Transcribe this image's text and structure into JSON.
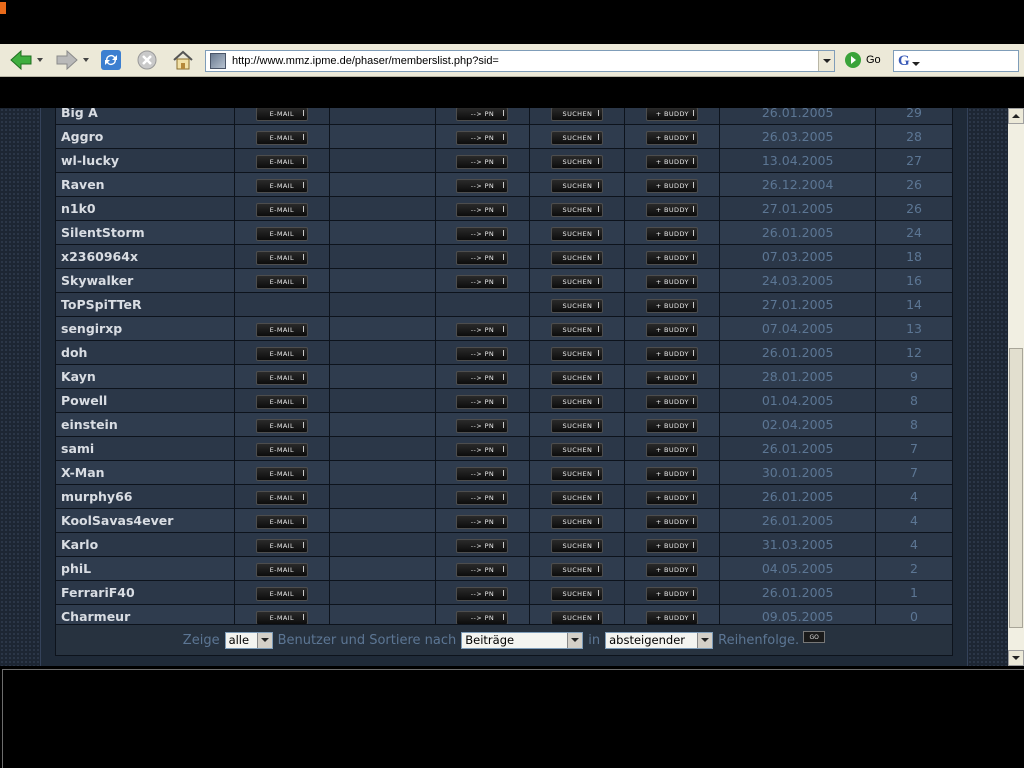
{
  "browser": {
    "url": "http://www.mmz.ipme.de/phaser/memberslist.php?sid=",
    "go_label": "Go",
    "search_engine_letter": "G"
  },
  "buttons": {
    "email": "E-MAIL",
    "pm": "--> PN",
    "search": "SUCHEN",
    "buddy": "+ BUDDY"
  },
  "members": [
    {
      "name": "Big A",
      "email": true,
      "pm": true,
      "date": "26.01.2005",
      "posts": "29"
    },
    {
      "name": "Aggro",
      "email": true,
      "pm": true,
      "date": "26.03.2005",
      "posts": "28"
    },
    {
      "name": "wl-lucky",
      "email": true,
      "pm": true,
      "date": "13.04.2005",
      "posts": "27"
    },
    {
      "name": "Raven",
      "email": true,
      "pm": true,
      "date": "26.12.2004",
      "posts": "26"
    },
    {
      "name": "n1k0",
      "email": true,
      "pm": true,
      "date": "27.01.2005",
      "posts": "26"
    },
    {
      "name": "SilentStorm",
      "email": true,
      "pm": true,
      "date": "26.01.2005",
      "posts": "24"
    },
    {
      "name": "x2360964x",
      "email": true,
      "pm": true,
      "date": "07.03.2005",
      "posts": "18"
    },
    {
      "name": "Skywalker",
      "email": true,
      "pm": true,
      "date": "24.03.2005",
      "posts": "16"
    },
    {
      "name": "ToPSpiTTeR",
      "email": false,
      "pm": false,
      "date": "27.01.2005",
      "posts": "14"
    },
    {
      "name": "sengirxp",
      "email": true,
      "pm": true,
      "date": "07.04.2005",
      "posts": "13"
    },
    {
      "name": "doh",
      "email": true,
      "pm": true,
      "date": "26.01.2005",
      "posts": "12"
    },
    {
      "name": "Kayn",
      "email": true,
      "pm": true,
      "date": "28.01.2005",
      "posts": "9"
    },
    {
      "name": "Powell",
      "email": true,
      "pm": true,
      "date": "01.04.2005",
      "posts": "8"
    },
    {
      "name": "einstein",
      "email": true,
      "pm": true,
      "date": "02.04.2005",
      "posts": "8"
    },
    {
      "name": "sami",
      "email": true,
      "pm": true,
      "date": "26.01.2005",
      "posts": "7"
    },
    {
      "name": "X-Man",
      "email": true,
      "pm": true,
      "date": "30.01.2005",
      "posts": "7"
    },
    {
      "name": "murphy66",
      "email": true,
      "pm": true,
      "date": "26.01.2005",
      "posts": "4"
    },
    {
      "name": "KoolSavas4ever",
      "email": true,
      "pm": true,
      "date": "26.01.2005",
      "posts": "4"
    },
    {
      "name": "Karlo",
      "email": true,
      "pm": true,
      "date": "31.03.2005",
      "posts": "4"
    },
    {
      "name": "phiL",
      "email": true,
      "pm": true,
      "date": "04.05.2005",
      "posts": "2"
    },
    {
      "name": "FerrariF40",
      "email": true,
      "pm": true,
      "date": "26.01.2005",
      "posts": "1"
    },
    {
      "name": "Charmeur",
      "email": true,
      "pm": true,
      "date": "09.05.2005",
      "posts": "0"
    }
  ],
  "footer": {
    "show_label": "Zeige",
    "show_value": "alle",
    "users_sort_label": "Benutzer und Sortiere nach",
    "sort_value": "Beiträge",
    "in_label": "in",
    "order_value": "absteigender",
    "order_label": "Reihenfolge.",
    "go_button": "GO"
  },
  "icons": {
    "back": "back-arrow-icon",
    "forward": "forward-arrow-icon",
    "refresh": "refresh-icon",
    "stop": "stop-icon",
    "home": "home-icon",
    "go": "go-arrow-icon"
  }
}
